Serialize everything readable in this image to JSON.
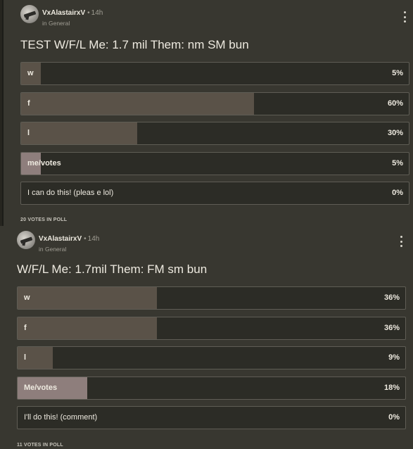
{
  "posts": [
    {
      "author": "VxAlastairxV",
      "separator": "•",
      "time": "14h",
      "channel": "in General",
      "title": "TEST W/F/L Me: 1.7 mil Them: nm SM bun",
      "options": [
        {
          "label": "w",
          "percent": "5%",
          "value": 5
        },
        {
          "label": "f",
          "percent": "60%",
          "value": 60
        },
        {
          "label": "l",
          "percent": "30%",
          "value": 30
        },
        {
          "label": "me/votes",
          "percent": "5%",
          "value": 5
        },
        {
          "label": "I can do this! (pleas e lol)",
          "percent": "0%",
          "value": 0
        }
      ],
      "votes_text": "20 VOTES IN POLL"
    },
    {
      "author": "VxAlastairxV",
      "separator": "•",
      "time": "14h",
      "channel": "in General",
      "title": "W/F/L Me: 1.7mil Them: FM sm bun",
      "options": [
        {
          "label": "w",
          "percent": "36%",
          "value": 36
        },
        {
          "label": "f",
          "percent": "36%",
          "value": 36
        },
        {
          "label": "l",
          "percent": "9%",
          "value": 9
        },
        {
          "label": "Me/votes",
          "percent": "18%",
          "value": 18
        },
        {
          "label": "I'll do this! (comment)",
          "percent": "0%",
          "value": 0
        }
      ],
      "votes_text": "11 VOTES IN POLL"
    }
  ],
  "colors": {
    "background": "#383730",
    "bar_fill": "#5a5248",
    "bar_fill_highlight": "#8e7e7c",
    "option_border": "#5f5d55"
  }
}
